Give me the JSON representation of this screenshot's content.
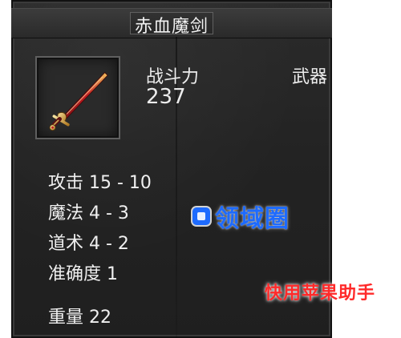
{
  "item": {
    "name": "赤血魔剑",
    "icon": "sword-icon"
  },
  "power": {
    "label": "战斗力",
    "value": "237"
  },
  "type": {
    "label": "武器"
  },
  "stats": [
    "攻击 15 - 10",
    "魔法 4 - 3",
    "道术 4 - 2",
    "准确度 1",
    "重量 22"
  ],
  "watermarks": {
    "brand": "领域圈",
    "caption": "快用苹果助手"
  },
  "colors": {
    "watermark_blue": "#1e6bff",
    "watermark_red": "#ff2a2a",
    "panel_text": "#f0f0f0"
  }
}
